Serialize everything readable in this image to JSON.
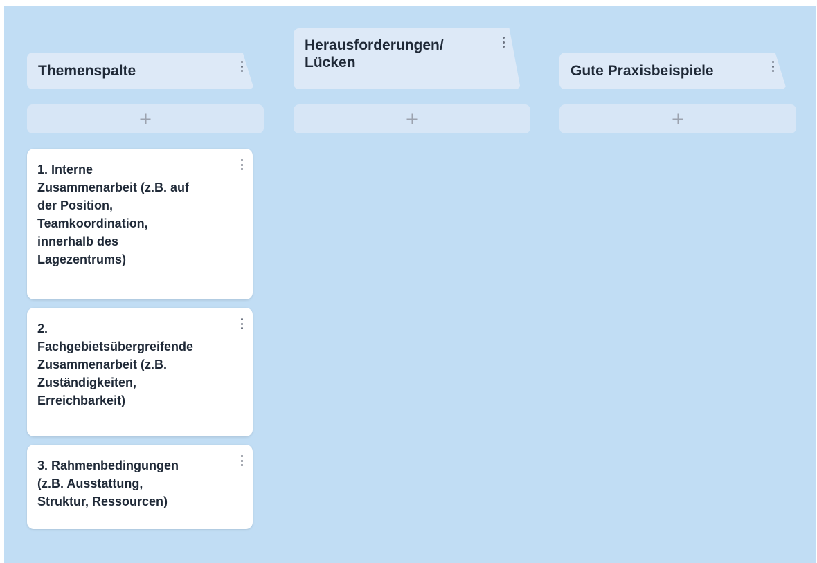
{
  "board": {
    "background": "#c1ddf4",
    "columns": [
      {
        "title": "Themenspalte",
        "add_icon": "plus-icon",
        "menu_icon": "kebab-menu-icon",
        "cards": [
          {
            "text": "1. Interne\nZusammenarbeit (z.B. auf\nder Position,\nTeamkoordination,\ninnerhalb des\nLagezentrums)"
          },
          {
            "text": "2.\nFachgebietsübergreifende\nZusammenarbeit (z.B.\nZuständigkeiten,\nErreichbarkeit)"
          },
          {
            "text": "3. Rahmenbedingungen\n(z.B. Ausstattung,\nStruktur, Ressourcen)"
          }
        ]
      },
      {
        "title": "Herausforderungen/\nLücken",
        "add_icon": "plus-icon",
        "menu_icon": "kebab-menu-icon",
        "cards": []
      },
      {
        "title": "Gute Praxisbeispiele",
        "add_icon": "plus-icon",
        "menu_icon": "kebab-menu-icon",
        "cards": []
      }
    ]
  }
}
